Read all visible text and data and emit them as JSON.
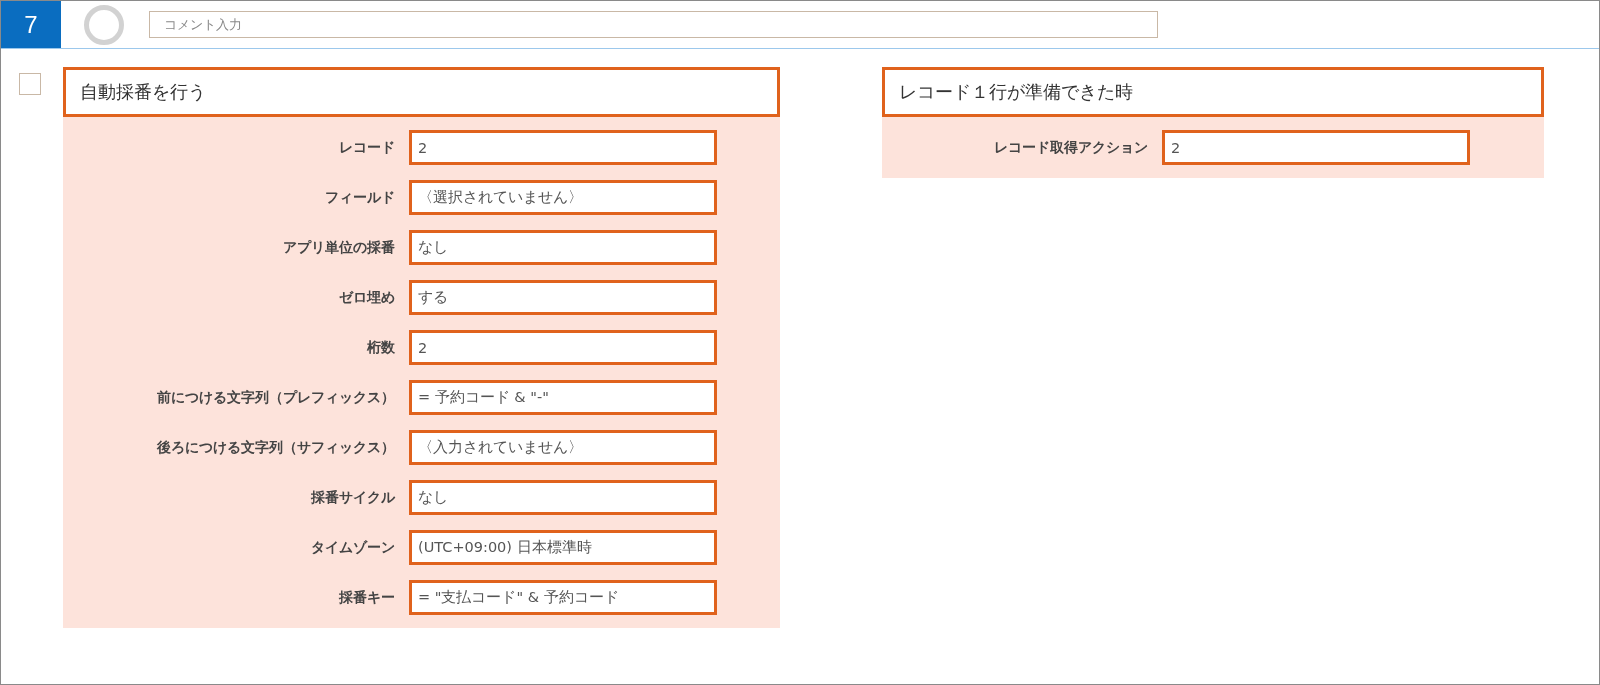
{
  "step": {
    "number": "7",
    "comment": {
      "placeholder": "コメント入力"
    }
  },
  "cards": [
    {
      "checked": false,
      "title": "自動採番を行う",
      "fields": [
        {
          "label": "レコード",
          "value": "2"
        },
        {
          "label": "フィールド",
          "value": "〈選択されていません〉"
        },
        {
          "label": "アプリ単位の採番",
          "value": "なし"
        },
        {
          "label": "ゼロ埋め",
          "value": "する"
        },
        {
          "label": "桁数",
          "value": "2"
        },
        {
          "label": "前につける文字列（プレフィックス）",
          "value": "= 予約コード & \"-\""
        },
        {
          "label": "後ろにつける文字列（サフィックス）",
          "value": "〈入力されていません〉"
        },
        {
          "label": "採番サイクル",
          "value": "なし"
        },
        {
          "label": "タイムゾーン",
          "value": "(UTC+09:00) 日本標準時"
        },
        {
          "label": "採番キー",
          "value": "= \"支払コード\" & 予約コード"
        }
      ]
    },
    {
      "title": "レコード１行が準備できた時",
      "fields": [
        {
          "label": "レコード取得アクション",
          "value": "2"
        }
      ]
    }
  ]
}
